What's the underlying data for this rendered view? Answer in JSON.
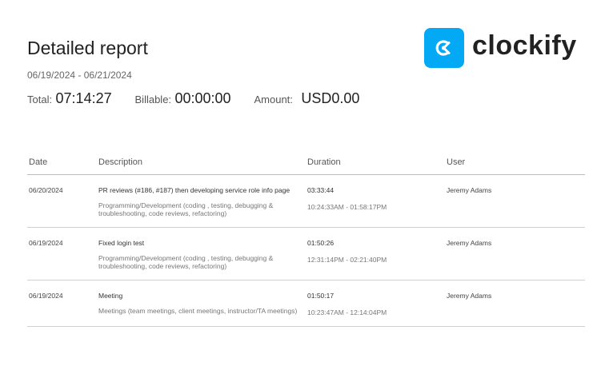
{
  "report": {
    "title": "Detailed report",
    "date_range": "06/19/2024 - 06/21/2024",
    "total_label": "Total:",
    "total_value": "07:14:27",
    "billable_label": "Billable:",
    "billable_value": "00:00:00",
    "amount_label": "Amount:",
    "amount_value": "USD0.00"
  },
  "logo": {
    "text": "clockify",
    "icon": "clockify-logo-icon",
    "brand_color": "#03a9f4"
  },
  "table": {
    "headers": {
      "date": "Date",
      "description": "Description",
      "duration": "Duration",
      "user": "User"
    },
    "rows": [
      {
        "date": "06/20/2024",
        "description": "PR reviews (#186, #187) then developing service role info page",
        "project": "Programming/Development (coding , testing, debugging & troubleshooting, code reviews, refactoring)",
        "duration": "03:33:44",
        "time_range": "10:24:33AM - 01:58:17PM",
        "user": "Jeremy Adams"
      },
      {
        "date": "06/19/2024",
        "description": "Fixed login test",
        "project": "Programming/Development (coding , testing, debugging & troubleshooting, code reviews, refactoring)",
        "duration": "01:50:26",
        "time_range": "12:31:14PM - 02:21:40PM",
        "user": "Jeremy Adams"
      },
      {
        "date": "06/19/2024",
        "description": "Meeting",
        "project": "Meetings (team meetings, client meetings, instructor/TA meetings)",
        "duration": "01:50:17",
        "time_range": "10:23:47AM - 12:14:04PM",
        "user": "Jeremy Adams"
      }
    ]
  }
}
